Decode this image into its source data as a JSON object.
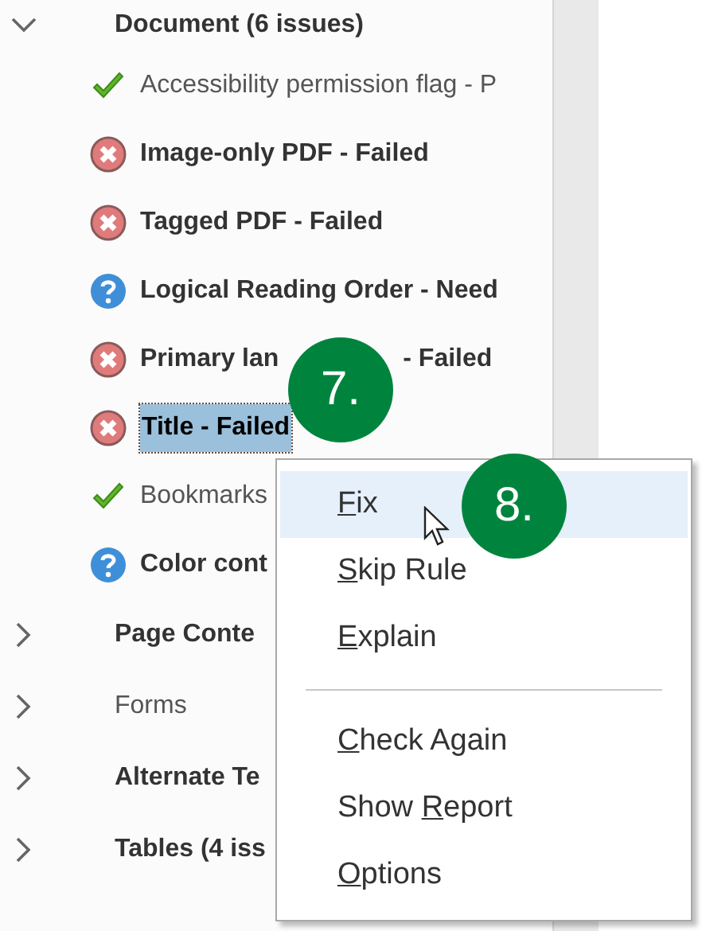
{
  "tree": {
    "label": "Document (6 issues)",
    "expanded": true,
    "has_issues": true,
    "children": [
      {
        "kind": "passed",
        "label": "Accessibility permission flag - P",
        "selected": false
      },
      {
        "kind": "failed",
        "label": "Image-only PDF - Failed",
        "selected": false
      },
      {
        "kind": "failed",
        "label": "Tagged PDF - Failed",
        "selected": false
      },
      {
        "kind": "needs_check",
        "label": "Logical Reading Order - Need",
        "selected": false
      },
      {
        "kind": "failed",
        "label": "Primary lan",
        "label_end": "- Failed",
        "selected": false
      },
      {
        "kind": "failed",
        "label": "Title - Failed",
        "selected": true
      },
      {
        "kind": "passed",
        "label": "Bookmarks",
        "selected": false
      },
      {
        "kind": "needs_check",
        "label": "Color cont",
        "selected": false
      }
    ]
  },
  "categories": [
    {
      "label": "Page Conte",
      "expanded": false,
      "has_issues": true
    },
    {
      "label": "Forms",
      "expanded": false,
      "has_issues": false
    },
    {
      "label": "Alternate Te",
      "expanded": false,
      "has_issues": true
    },
    {
      "label": "Tables (4 iss",
      "expanded": false,
      "has_issues": true
    }
  ],
  "context_menu": [
    {
      "kind": "item",
      "key": "F",
      "post": "ix",
      "highlighted": true
    },
    {
      "kind": "item",
      "key": "S",
      "post": "kip Rule",
      "highlighted": false
    },
    {
      "kind": "item",
      "key": "E",
      "post": "xplain",
      "highlighted": false
    },
    {
      "kind": "separator"
    },
    {
      "kind": "item",
      "key": "C",
      "post": "heck Again",
      "highlighted": false
    },
    {
      "kind": "item",
      "pre": "Show ",
      "key": "R",
      "post": "eport",
      "highlighted": false
    },
    {
      "kind": "item",
      "key": "O",
      "post": "ptions",
      "highlighted": false
    }
  ],
  "step_badges": [
    "7.",
    "8."
  ]
}
